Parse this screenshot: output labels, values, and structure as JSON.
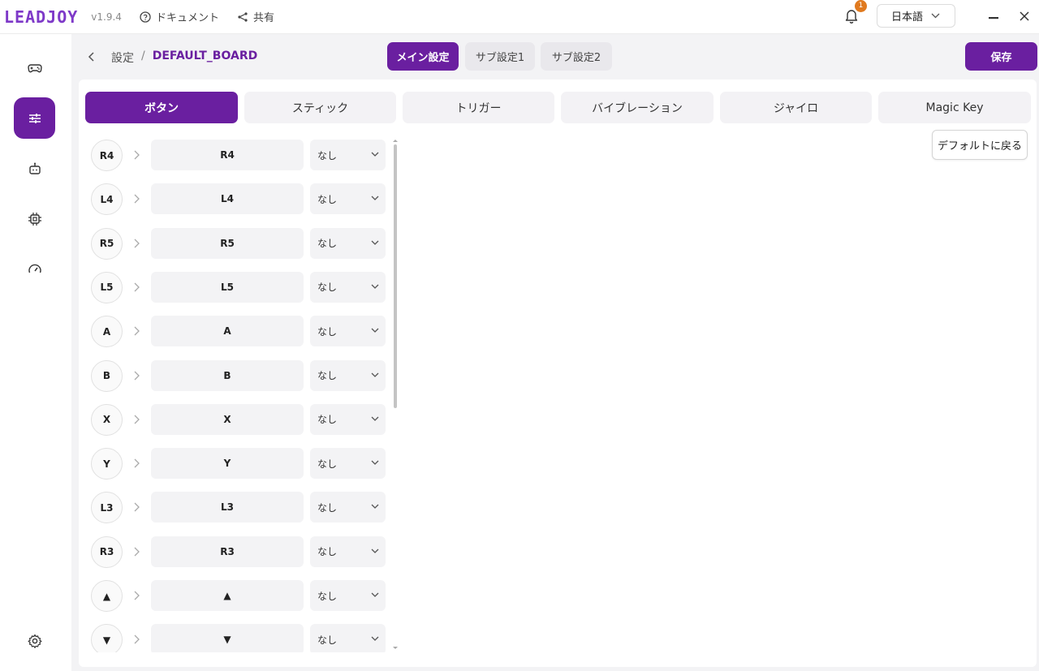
{
  "app": {
    "logo": "LEADJOY",
    "version": "v1.9.4"
  },
  "top_links": {
    "docs": "ドキュメント",
    "share": "共有"
  },
  "notifications": {
    "count": "1"
  },
  "language": {
    "selected": "日本語"
  },
  "breadcrumb": {
    "parent": "設定",
    "separator": "/",
    "current": "DEFAULT_BOARD"
  },
  "segments": [
    "メイン設定",
    "サブ設定1",
    "サブ設定2"
  ],
  "actions": {
    "save": "保存",
    "reset_default": "デフォルトに戻る"
  },
  "tabs": [
    "ボタン",
    "スティック",
    "トリガー",
    "バイブレーション",
    "ジャイロ",
    "Magic Key"
  ],
  "sidebar": {
    "items": [
      {
        "icon": "gamepad-icon"
      },
      {
        "icon": "sliders-icon"
      },
      {
        "icon": "robot-icon"
      },
      {
        "icon": "chip-icon"
      },
      {
        "icon": "gauge-icon"
      }
    ],
    "bottom_icon": "gear-icon"
  },
  "button_rows": [
    {
      "badge": "R4",
      "mapping": "R4",
      "option": "なし"
    },
    {
      "badge": "L4",
      "mapping": "L4",
      "option": "なし"
    },
    {
      "badge": "R5",
      "mapping": "R5",
      "option": "なし"
    },
    {
      "badge": "L5",
      "mapping": "L5",
      "option": "なし"
    },
    {
      "badge": "A",
      "mapping": "A",
      "option": "なし"
    },
    {
      "badge": "B",
      "mapping": "B",
      "option": "なし"
    },
    {
      "badge": "X",
      "mapping": "X",
      "option": "なし"
    },
    {
      "badge": "Y",
      "mapping": "Y",
      "option": "なし"
    },
    {
      "badge": "L3",
      "mapping": "L3",
      "option": "なし"
    },
    {
      "badge": "R3",
      "mapping": "R3",
      "option": "なし"
    },
    {
      "badge": "▲",
      "mapping": "▲",
      "option": "なし"
    },
    {
      "badge": "▼",
      "mapping": "▼",
      "option": "なし"
    }
  ],
  "colors": {
    "accent": "#6a1fa0",
    "logo": "#7e39c8",
    "badge": "#e07a1f"
  }
}
